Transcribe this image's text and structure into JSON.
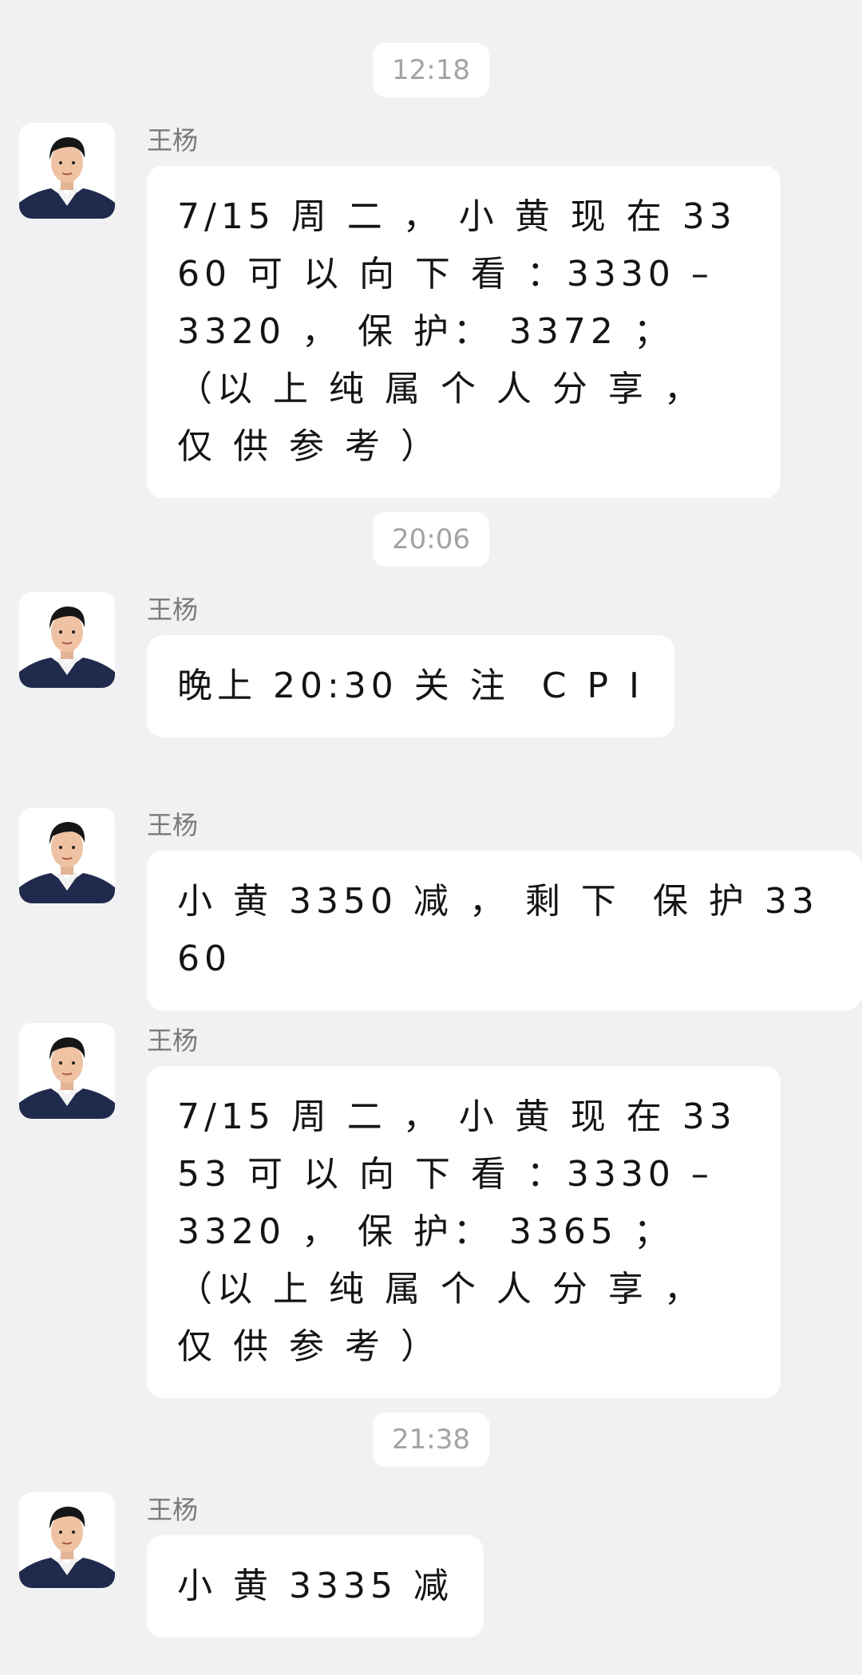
{
  "messages": [
    {
      "time": "12:18",
      "sender": "王杨",
      "text": "7/15 周 二 ， 小 黄 现 在 3360 可 以 向 下 看 ：3330 – 3320 ， 保 护： 3372 ；  （以 上 纯 属 个 人 分 享 ， 仅 供 参 考 ）"
    },
    {
      "time": "20:06",
      "sender": "王杨",
      "text": "晚上 20:30 关 注  C P I"
    },
    {
      "sender": "王杨",
      "text": "小 黄 3350 减 ， 剩 下  保 护 3360"
    },
    {
      "sender": "王杨",
      "text": "7/15 周 二 ， 小 黄 现 在 3353 可 以 向 下 看 ：3330 – 3320 ， 保 护： 3365 ；  （以 上 纯 属 个 人 分 享 ， 仅 供 参 考 ）"
    },
    {
      "time": "21:38",
      "sender": "王杨",
      "text": "小 黄 3335 减"
    }
  ],
  "avatar_icon": "person-portrait-avatar"
}
